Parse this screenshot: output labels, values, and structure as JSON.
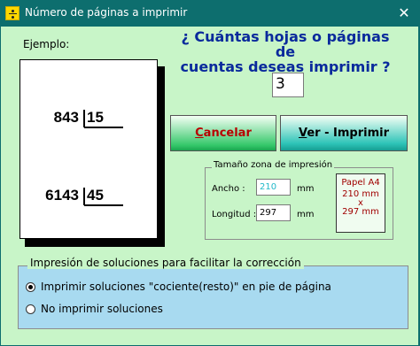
{
  "window": {
    "title": "Número de páginas a imprimir",
    "close_glyph": "✕"
  },
  "example": {
    "label": "Ejemplo:",
    "divisions": [
      {
        "dividend": "843",
        "divisor": "15"
      },
      {
        "dividend": "6143",
        "divisor": "45"
      }
    ]
  },
  "question": {
    "line1": "¿ Cuántas hojas o páginas de",
    "line2": "cuentas deseas imprimir ?",
    "value": "3"
  },
  "buttons": {
    "cancel_mnemonic": "C",
    "cancel_rest": "ancelar",
    "ver_mnemonic": "V",
    "ver_rest": "er - Imprimir"
  },
  "print_zone": {
    "legend": "Tamaño zona de impresión",
    "width_label": "Ancho :",
    "width_value": "210",
    "width_unit": "mm",
    "length_label": "Longitud :",
    "length_value": "297",
    "length_unit": "mm",
    "paper_lines": [
      "Papel A4",
      "210 mm",
      "x",
      "297 mm"
    ]
  },
  "solutions": {
    "legend": "Impresión de soluciones para facilitar la corrección",
    "options": [
      {
        "label": "Imprimir soluciones \"cociente(resto)\" en pie de página",
        "checked": true
      },
      {
        "label": "No imprimir soluciones",
        "checked": false
      }
    ]
  },
  "colors": {
    "title_bar": "#0d6e6e",
    "client_bg": "#c8f5c8",
    "question_text": "#0a2a9c",
    "cancel_text": "#b80000",
    "panel_bg": "#a8daf0"
  }
}
